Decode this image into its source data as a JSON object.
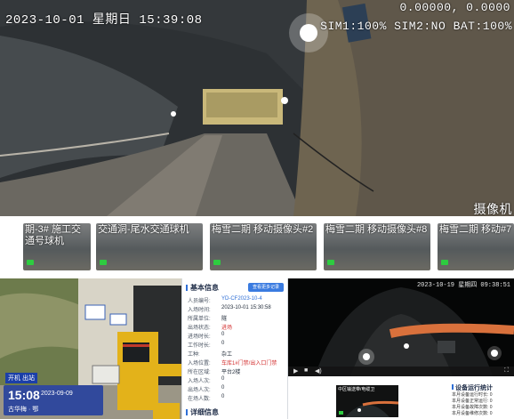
{
  "main_camera": {
    "date": "2023-10-01",
    "weekday": "星期日",
    "time": "15:39:08",
    "coords": "0.00000, 0.0000",
    "status_line": "SIM1:100% SIM2:NO BAT:100%",
    "corner_label": "摄像机"
  },
  "camera_thumbnails": [
    {
      "label": "期-3# 施工交通号球机"
    },
    {
      "label": "交通洞-尾水交通球机"
    },
    {
      "label": "梅雪二期 移动摄像头#2"
    },
    {
      "label": "梅雪二期 移动摄像头#8"
    },
    {
      "label": "梅雪二期 移动#7"
    }
  ],
  "gate_photo": {
    "badge": "开机 出站",
    "time": "15:08",
    "date": "2023-09-09",
    "name_line": "古华梅 · 鄂"
  },
  "info_panel": {
    "section_basic": "基本信息",
    "action_button": "查看更多记录",
    "section_record": "详细信息",
    "rows": [
      {
        "label": "人员编号:",
        "value": "YD-CF2023-10-4",
        "style": "link"
      },
      {
        "label": "入场时间:",
        "value": "2023-10-01 15:30:58",
        "style": ""
      },
      {
        "label": "所属单位:",
        "value": "隧",
        "style": ""
      },
      {
        "label": "出场状态:",
        "value": "进场",
        "style": "red"
      },
      {
        "label": "进场时长:",
        "value": "0",
        "style": ""
      },
      {
        "label": "工作时长:",
        "value": "0",
        "style": ""
      },
      {
        "label": "工种:",
        "value": "杂工",
        "style": ""
      },
      {
        "label": "入场位置:",
        "value": "车库1#门禁/出入口门禁",
        "style": "red"
      },
      {
        "label": "所在区域:",
        "value": "平台2楼",
        "style": ""
      },
      {
        "label": "入场人次:",
        "value": "0",
        "style": ""
      },
      {
        "label": "出场人次:",
        "value": "0",
        "style": ""
      },
      {
        "label": "在场人数:",
        "value": "0",
        "style": ""
      },
      {
        "label": "累计人次:",
        "value": "0",
        "style": ""
      }
    ]
  },
  "tunnel_video": {
    "timestamp": "2023-10-19 星期四 09:38:51",
    "controls": [
      "▶",
      "■",
      "◀)",
      "⛶"
    ]
  },
  "mini_video": {
    "label": "中区输送带/电缆卫"
  },
  "stats_panel": {
    "title": "设备运行统计",
    "lines": [
      "本月设备运行时长: 0",
      "本月设备正常运行: 0",
      "本月设备故障次数: 0",
      "本月设备维修次数: 0"
    ]
  },
  "colors": {
    "accent": "#2f6fd6",
    "online": "#2ecc40",
    "alert": "#d32f2f"
  }
}
